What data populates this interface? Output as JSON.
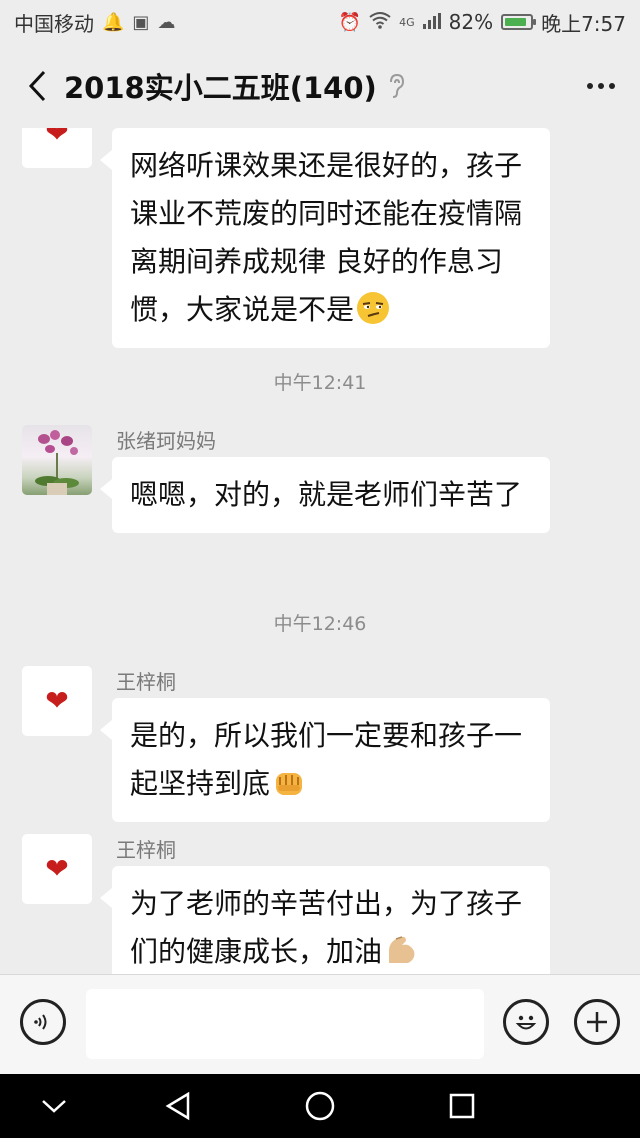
{
  "status_bar": {
    "carrier": "中国移动",
    "network": "4G",
    "battery": "82%",
    "time": "晚上7:57"
  },
  "title_bar": {
    "title": "2018实小二五班(140)"
  },
  "messages": [
    {
      "sender": "",
      "avatar": "heart-avatar",
      "text": "网络听课效果还是很好的，孩子课业不荒废的同时还能在疫情隔离期间养成规律 良好的作息习惯，大家说是不是",
      "emoji": "smirk-emoji"
    },
    {
      "sender": "张绪珂妈妈",
      "avatar": "flower-photo-avatar",
      "text": "嗯嗯，对的，就是老师们辛苦了",
      "emoji": ""
    },
    {
      "sender": "王梓桐",
      "avatar": "heart-avatar",
      "text": "是的，所以我们一定要和孩子一起坚持到底",
      "emoji": "fist-emoji"
    },
    {
      "sender": "王梓桐",
      "avatar": "heart-avatar",
      "text": "为了老师的辛苦付出，为了孩子们的健康成长，加油",
      "emoji": "flexed-biceps-emoji"
    }
  ],
  "timestamps": [
    "中午12:41",
    "中午12:46"
  ],
  "input_bar": {
    "text": ""
  }
}
